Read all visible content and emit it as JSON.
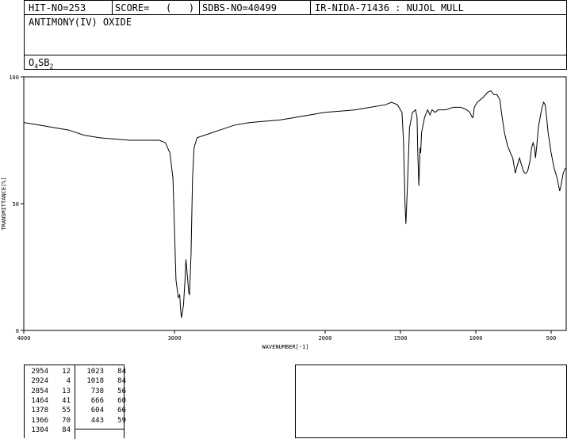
{
  "header": {
    "hit_no": "HIT-NO=253",
    "score_label": "SCORE=",
    "score_value": "(   )",
    "sdbs_no": "SDBS-NO=40499",
    "ir_nida": "IR-NIDA-71436 : NUJOL MULL"
  },
  "compound": {
    "name": "ANTIMONY(IV) OXIDE",
    "formula_parts": [
      "O",
      "4",
      "SB",
      "2"
    ]
  },
  "chart_data": {
    "type": "line",
    "title": "",
    "xlabel": "WAVENUMBER[-1]",
    "ylabel": "TRANSMITTANCE[%]",
    "xlim": [
      4000,
      400
    ],
    "ylim": [
      0,
      100
    ],
    "x_ticks": [
      4000,
      3000,
      2000,
      1500,
      1000,
      500
    ],
    "y_ticks": [
      0,
      50,
      100
    ],
    "grid": false,
    "series": [
      {
        "name": "",
        "points": [
          [
            4000,
            82
          ],
          [
            3900,
            81
          ],
          [
            3800,
            80
          ],
          [
            3700,
            79
          ],
          [
            3600,
            77
          ],
          [
            3500,
            76
          ],
          [
            3400,
            75.5
          ],
          [
            3300,
            75
          ],
          [
            3200,
            75
          ],
          [
            3150,
            75
          ],
          [
            3100,
            75
          ],
          [
            3060,
            74
          ],
          [
            3030,
            70
          ],
          [
            3010,
            60
          ],
          [
            3000,
            40
          ],
          [
            2990,
            20
          ],
          [
            2975,
            13
          ],
          [
            2965,
            14
          ],
          [
            2960,
            9
          ],
          [
            2954,
            5
          ],
          [
            2948,
            7
          ],
          [
            2940,
            10
          ],
          [
            2930,
            20
          ],
          [
            2924,
            28
          ],
          [
            2915,
            22
          ],
          [
            2905,
            15
          ],
          [
            2900,
            14
          ],
          [
            2890,
            30
          ],
          [
            2880,
            60
          ],
          [
            2870,
            72
          ],
          [
            2850,
            76
          ],
          [
            2800,
            77
          ],
          [
            2700,
            79
          ],
          [
            2600,
            81
          ],
          [
            2500,
            82
          ],
          [
            2400,
            82.5
          ],
          [
            2300,
            83
          ],
          [
            2200,
            84
          ],
          [
            2100,
            85
          ],
          [
            2000,
            86
          ],
          [
            1900,
            86.5
          ],
          [
            1800,
            87
          ],
          [
            1700,
            88
          ],
          [
            1600,
            89
          ],
          [
            1560,
            90
          ],
          [
            1520,
            89
          ],
          [
            1500,
            87
          ],
          [
            1490,
            86
          ],
          [
            1480,
            75
          ],
          [
            1470,
            50
          ],
          [
            1464,
            42
          ],
          [
            1455,
            55
          ],
          [
            1440,
            80
          ],
          [
            1420,
            86
          ],
          [
            1400,
            87
          ],
          [
            1390,
            84
          ],
          [
            1385,
            70
          ],
          [
            1378,
            57
          ],
          [
            1370,
            72
          ],
          [
            1366,
            70
          ],
          [
            1360,
            78
          ],
          [
            1340,
            84
          ],
          [
            1320,
            87
          ],
          [
            1304,
            85
          ],
          [
            1290,
            87
          ],
          [
            1270,
            86
          ],
          [
            1250,
            87
          ],
          [
            1200,
            87
          ],
          [
            1150,
            88
          ],
          [
            1100,
            88
          ],
          [
            1060,
            87
          ],
          [
            1040,
            86
          ],
          [
            1023,
            84
          ],
          [
            1018,
            84
          ],
          [
            1010,
            88
          ],
          [
            990,
            90
          ],
          [
            950,
            92
          ],
          [
            920,
            94
          ],
          [
            900,
            94.5
          ],
          [
            880,
            93
          ],
          [
            860,
            93
          ],
          [
            840,
            91
          ],
          [
            830,
            86
          ],
          [
            820,
            82
          ],
          [
            810,
            78
          ],
          [
            790,
            73
          ],
          [
            770,
            70
          ],
          [
            755,
            68
          ],
          [
            738,
            62
          ],
          [
            725,
            65
          ],
          [
            710,
            68
          ],
          [
            700,
            66
          ],
          [
            685,
            63
          ],
          [
            675,
            62
          ],
          [
            666,
            62
          ],
          [
            655,
            63
          ],
          [
            640,
            67
          ],
          [
            630,
            72
          ],
          [
            620,
            74
          ],
          [
            610,
            72
          ],
          [
            604,
            68
          ],
          [
            595,
            73
          ],
          [
            585,
            80
          ],
          [
            570,
            85
          ],
          [
            560,
            88
          ],
          [
            550,
            90
          ],
          [
            540,
            89
          ],
          [
            530,
            84
          ],
          [
            520,
            78
          ],
          [
            500,
            70
          ],
          [
            480,
            64
          ],
          [
            460,
            60
          ],
          [
            450,
            57
          ],
          [
            443,
            55
          ],
          [
            435,
            57
          ],
          [
            420,
            62
          ],
          [
            405,
            64
          ],
          [
            400,
            64
          ]
        ]
      }
    ],
    "peak_table": [
      {
        "wavenumber": 2954,
        "transmittance": 12
      },
      {
        "wavenumber": 2924,
        "transmittance": 4
      },
      {
        "wavenumber": 2854,
        "transmittance": 13
      },
      {
        "wavenumber": 1464,
        "transmittance": 41
      },
      {
        "wavenumber": 1378,
        "transmittance": 55
      },
      {
        "wavenumber": 1366,
        "transmittance": 70
      },
      {
        "wavenumber": 1304,
        "transmittance": 84
      },
      {
        "wavenumber": 1023,
        "transmittance": 84
      },
      {
        "wavenumber": 1018,
        "transmittance": 84
      },
      {
        "wavenumber": 738,
        "transmittance": 56
      },
      {
        "wavenumber": 666,
        "transmittance": 60
      },
      {
        "wavenumber": 604,
        "transmittance": 66
      },
      {
        "wavenumber": 443,
        "transmittance": 59
      }
    ]
  }
}
